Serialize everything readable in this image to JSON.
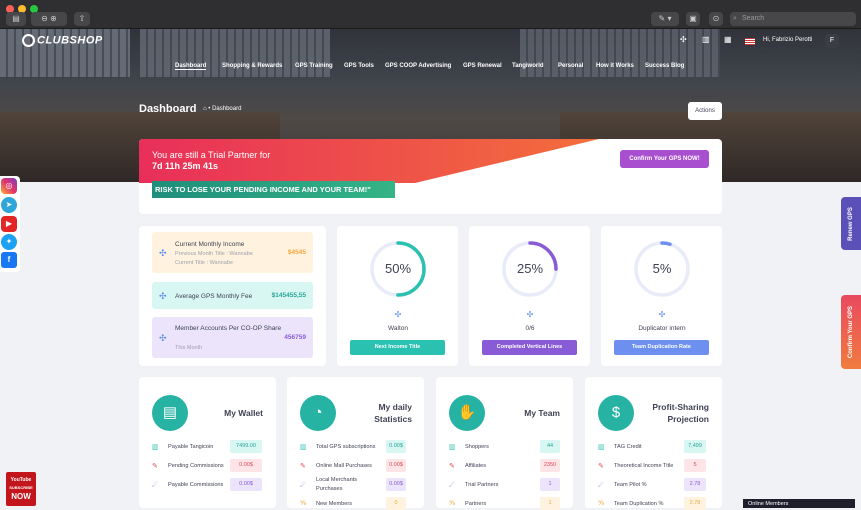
{
  "browser": {
    "search_placeholder": "Search"
  },
  "brand": {
    "logo_text": "CLUBSHOP"
  },
  "nav": {
    "items": [
      "Dashboard",
      "Shopping & Rewards",
      "GPS Training",
      "GPS Tools",
      "GPS COOP Advertising",
      "GPS Renewal",
      "Tangiworld",
      "Personal",
      "How it Works",
      "Success Blog"
    ]
  },
  "user": {
    "greeting": "Hi, Fabrizio Perotti",
    "avatar_letter": "F"
  },
  "page": {
    "title": "Dashboard",
    "breadcrumb": "• Dashboard",
    "actions_label": "Actions"
  },
  "trial": {
    "line1": "You are still a Trial Partner for",
    "countdown": "7d 11h 25m 41s",
    "confirm_label": "Confirm Your GPS NOW!",
    "risk": "RISK TO LOSE YOUR PENDING INCOME AND YOUR TEAM!\""
  },
  "income": {
    "label": "Current Monthly Income",
    "prev_title": "Previous Month Title : Wannabe",
    "curr_title": "Current Title : Wannabe",
    "value": "$4545",
    "value_color": "#f0a53a"
  },
  "gps_fee": {
    "label": "Average GPS Monthly Fee",
    "value": "$145455,55",
    "value_color": "#26a69a"
  },
  "coop": {
    "label": "Member Accounts Per CO-OP Share",
    "sub": "This Month",
    "value": "456759",
    "value_color": "#8a5bd6"
  },
  "rings": [
    {
      "percent": 50,
      "pct_label": "50%",
      "label": "Walton",
      "button": "Next Income Title",
      "color": "#2bc1b1"
    },
    {
      "percent": 25,
      "pct_label": "25%",
      "label": "0/6",
      "button": "Completed Vertical Lines",
      "color": "#8a5bd6"
    },
    {
      "percent": 5,
      "pct_label": "5%",
      "label": "Duplicator intern",
      "button": "Team Duplication Rate",
      "color": "#6c8ff0"
    }
  ],
  "wallet": {
    "title": "My Wallet",
    "rows": [
      {
        "label": "Payable Tangicoin",
        "value": "7499.00"
      },
      {
        "label": "Pending Commissions",
        "value": "0.00$"
      },
      {
        "label": "Payable Commissions",
        "value": "0.00$"
      }
    ]
  },
  "daily": {
    "title": "My daily",
    "title2": "Statistics",
    "rows": [
      {
        "label": "Total GPS subscriptions",
        "value": "0.00$"
      },
      {
        "label": "Online Mall Purchases",
        "value": "0.00$"
      },
      {
        "label": "Local Merchants",
        "label2": "Purchases",
        "value": "0.00$"
      },
      {
        "label": "New Members",
        "value": "0"
      }
    ]
  },
  "team": {
    "title": "My Team",
    "rows": [
      {
        "label": "Shoppers",
        "value": "44"
      },
      {
        "label": "Affiliates",
        "value": "2350"
      },
      {
        "label": "Trial Partners",
        "value": "1"
      },
      {
        "label": "Partners",
        "value": "1"
      }
    ]
  },
  "profit": {
    "title": "Profit-Sharing",
    "title2": "Projection",
    "rows": [
      {
        "label": "TAG Credit",
        "value": "7,499"
      },
      {
        "label": "Theoretical Income Title",
        "value": "5"
      },
      {
        "label": "Team Pilot %",
        "value": "2.78"
      },
      {
        "label": "Team Duplication %",
        "value": "2.78"
      }
    ]
  },
  "side_right": {
    "renew": "Renew GPS",
    "confirm": "Confirm Your GPS"
  },
  "youtube": {
    "line1": "YouTube",
    "line2": "SUBSCRIBE",
    "line3": "NOW"
  },
  "online": {
    "label": "Online Members"
  }
}
